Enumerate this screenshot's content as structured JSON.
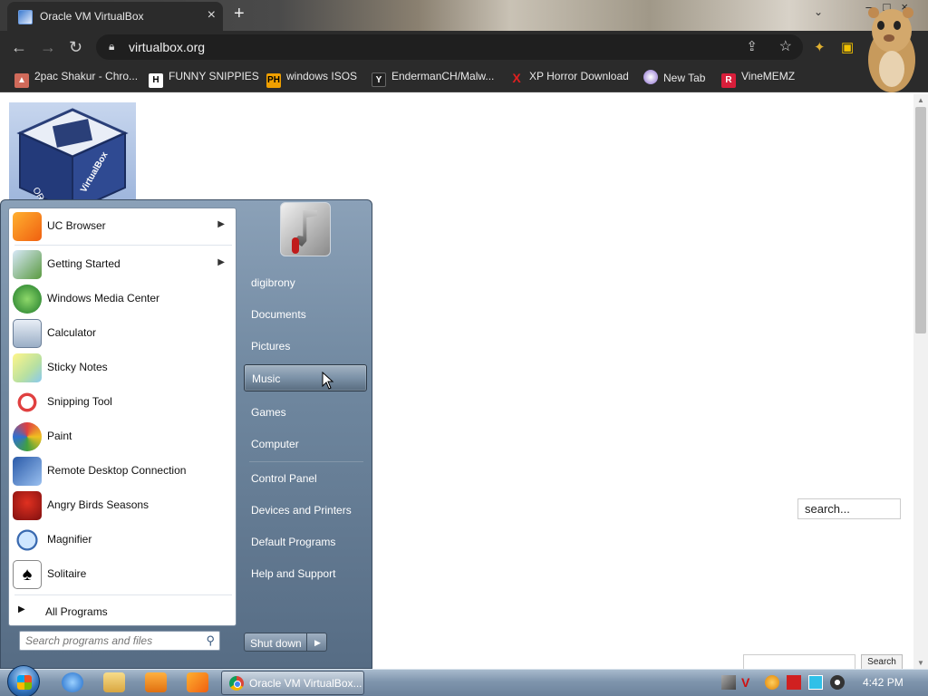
{
  "browser": {
    "tab_title": "Oracle VM VirtualBox",
    "url": "virtualbox.org",
    "bookmarks": [
      {
        "label": "2pac Shakur - Chro...",
        "icon": "cake-icon"
      },
      {
        "label": "FUNNY SNIPPIES",
        "icon": "h-icon"
      },
      {
        "label": "windows ISOS",
        "icon": "ph-icon"
      },
      {
        "label": "EndermanCH/Malw...",
        "icon": "yp-icon"
      },
      {
        "label": "XP Horror Download",
        "icon": "x-icon"
      },
      {
        "label": "New Tab",
        "icon": "globe-icon"
      },
      {
        "label": "VineMEMZ",
        "icon": "r-icon"
      }
    ]
  },
  "page": {
    "search_placeholder": "search...",
    "search_button": "Search"
  },
  "start_menu": {
    "programs": [
      {
        "label": "UC Browser",
        "has_submenu": true
      },
      {
        "label": "Getting Started",
        "has_submenu": true
      },
      {
        "label": "Windows Media Center",
        "has_submenu": false
      },
      {
        "label": "Calculator",
        "has_submenu": false
      },
      {
        "label": "Sticky Notes",
        "has_submenu": false
      },
      {
        "label": "Snipping Tool",
        "has_submenu": false
      },
      {
        "label": "Paint",
        "has_submenu": false
      },
      {
        "label": "Remote Desktop Connection",
        "has_submenu": false
      },
      {
        "label": "Angry Birds Seasons",
        "has_submenu": false
      },
      {
        "label": "Magnifier",
        "has_submenu": false
      },
      {
        "label": "Solitaire",
        "has_submenu": false
      }
    ],
    "all_programs": "All Programs",
    "search_placeholder": "Search programs and files",
    "right_links": [
      {
        "label": "digibrony"
      },
      {
        "label": "Documents"
      },
      {
        "label": "Pictures"
      },
      {
        "label": "Music"
      },
      {
        "label": "Games"
      },
      {
        "label": "Computer"
      },
      {
        "label": "Control Panel"
      },
      {
        "label": "Devices and Printers"
      },
      {
        "label": "Default Programs"
      },
      {
        "label": "Help and Support"
      }
    ],
    "hovered_item": "Music",
    "shutdown_label": "Shut down"
  },
  "taskbar": {
    "active_window": "Oracle VM VirtualBox...",
    "clock": "4:42 PM"
  },
  "colors": {
    "chrome_dark": "#2b2b2b",
    "start_menu_blue": "#6f879f",
    "taskbar_blue": "#7f95ad"
  }
}
